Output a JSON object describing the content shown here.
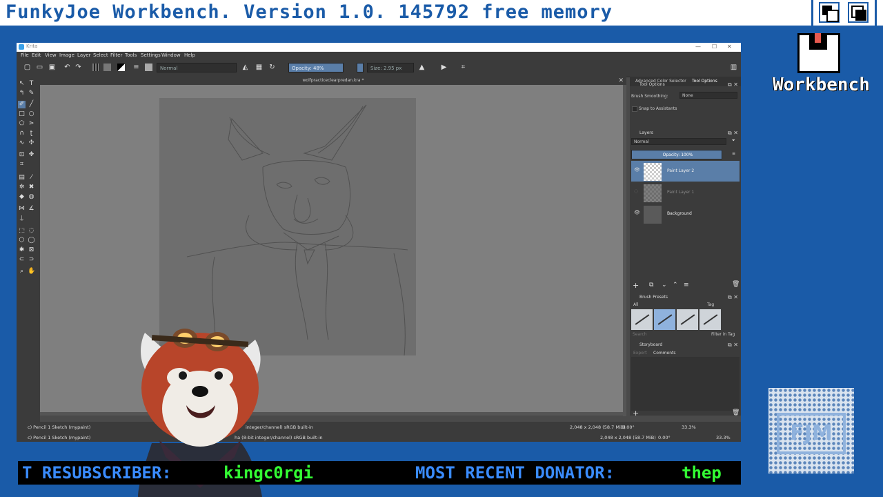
{
  "workbench": {
    "title": "FunkyJoe Workbench.  Version 1.0.  145792 free memory",
    "disk_label": "Workbench"
  },
  "krita": {
    "window_title": "Krita",
    "menu": [
      "File",
      "Edit",
      "View",
      "Image",
      "Layer",
      "Select",
      "Filter",
      "Tools",
      "Settings",
      "Window",
      "Help"
    ],
    "toolbar": {
      "blend_mode": "Normal",
      "opacity": "Opacity: 48%",
      "size": "Size: 2.95 px"
    },
    "document_tab": "wolfpracticeclearpredan.kra *",
    "dock_tabs": [
      "Advanced Color Selector",
      "Tool Options"
    ],
    "tool_options": {
      "title": "Tool Options",
      "smoothing_label": "Brush Smoothing:",
      "smoothing_value": "None",
      "snap_label": "Snap to Assistants"
    },
    "layers": {
      "title": "Layers",
      "blend": "Normal",
      "opacity": "Opacity:  100%",
      "items": [
        {
          "name": "Paint Layer 2"
        },
        {
          "name": "Paint Layer 1"
        },
        {
          "name": "Background"
        }
      ]
    },
    "brush_presets": {
      "title": "Brush Presets",
      "filter": "All",
      "tag": "Tag",
      "search": "Search",
      "filter_in_tag": "Filter in Tag"
    },
    "storyboard": {
      "title": "Storyboard",
      "export": "Export",
      "comments": "Comments"
    },
    "status": {
      "brush_top": "c) Pencil 1 Sketch (mypaint)",
      "brush_bottom": "c) Pencil 1 Sketch (mypaint)",
      "color_top": "integer/channel)  sRGB built-in",
      "color_bottom": "ha (8-bit integer/channel)  sRGB built-in",
      "dims_top": "2,048 x 2,048 (58.7 MiB)",
      "dims_bottom": "2,048 x 2,048 (58.7 MiB)",
      "rot_top": "0.00°",
      "rot_bottom": "0.00°",
      "zoom_top": "33.3%",
      "zoom_bottom": "33.3%"
    }
  },
  "ticker": {
    "resub_label": "T RESUBSCRIBER:",
    "resub_value": "kingc0rgi",
    "donator_label": "MOST RECENT DONATOR:",
    "donator_value": "thep"
  },
  "colors": {
    "workbench_blue": "#1a5ba8",
    "krita_selected": "#5a7ea8",
    "ticker_label": "#3a8cff",
    "ticker_value": "#33ff33"
  }
}
